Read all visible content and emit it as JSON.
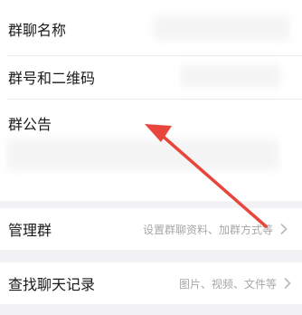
{
  "settings": {
    "group_name": {
      "label": "群聊名称"
    },
    "group_qr": {
      "label": "群号和二维码"
    },
    "announcement": {
      "label": "群公告"
    },
    "manage": {
      "label": "管理群",
      "detail": "设置群聊资料、加群方式等"
    },
    "search_history": {
      "label": "查找聊天记录",
      "detail": "图片、视频、文件等"
    }
  },
  "icons": {
    "chevron": "chevron-right-icon",
    "annotation": "annotation-arrow-icon"
  },
  "colors": {
    "annotation": "#e8453c",
    "page_background": "#f2f2f5",
    "detail_text": "#a7a7a7"
  }
}
